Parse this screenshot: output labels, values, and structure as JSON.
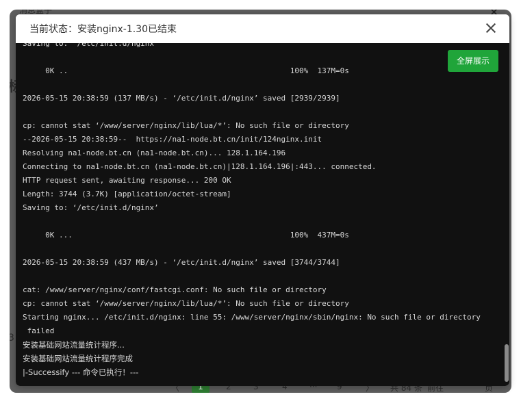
{
  "background": {
    "top_tab_label": "消息盒子",
    "close_glyph": "✕",
    "side_letter": "标",
    "side_digit": "3",
    "pager": {
      "prev": "〈",
      "pages": [
        "1",
        "2",
        "3",
        "4",
        "···",
        "9"
      ],
      "active_index": 0,
      "next": "〉",
      "total": "共 84 条",
      "goto": "前往",
      "page_unit": "页"
    }
  },
  "modal": {
    "title": "当前状态：安装nginx-1.30已结束",
    "fullscreen_label": "全屏展示"
  },
  "log_lines": [
    "Saving to: ‘/etc/init.d/nginx’",
    "",
    "     0K ..                                                 100%  137M=0s",
    "",
    "2026-05-15 20:38:59 (137 MB/s) - ‘/etc/init.d/nginx’ saved [2939/2939]",
    "",
    "cp: cannot stat ‘/www/server/nginx/lib/lua/*’: No such file or directory",
    "--2026-05-15 20:38:59--  https://na1-node.bt.cn/init/124nginx.init",
    "Resolving na1-node.bt.cn (na1-node.bt.cn)... 128.1.164.196",
    "Connecting to na1-node.bt.cn (na1-node.bt.cn)|128.1.164.196|:443... connected.",
    "HTTP request sent, awaiting response... 200 OK",
    "Length: 3744 (3.7K) [application/octet-stream]",
    "Saving to: ‘/etc/init.d/nginx’",
    "",
    "     0K ...                                                100%  437M=0s",
    "",
    "2026-05-15 20:38:59 (437 MB/s) - ‘/etc/init.d/nginx’ saved [3744/3744]",
    "",
    "cat: /www/server/nginx/conf/fastcgi.conf: No such file or directory",
    "cp: cannot stat ‘/www/server/nginx/lib/lua/*’: No such file or directory",
    "Starting nginx... /etc/init.d/nginx: line 55: /www/server/nginx/sbin/nginx: No such file or directory",
    " failed",
    "安装基础网站流量统计程序...",
    "安装基础网站流量统计程序完成",
    "|-Successify --- 命令已执行！---"
  ]
}
